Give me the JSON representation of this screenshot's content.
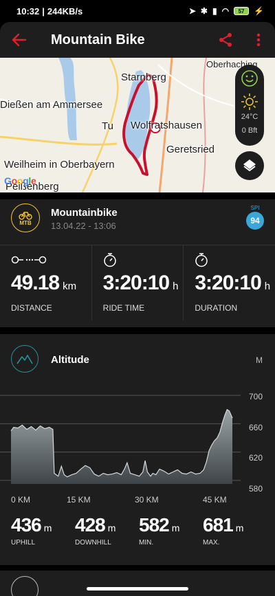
{
  "status": {
    "time": "10:32",
    "speed": "244KB/s",
    "battery": "57"
  },
  "header": {
    "title": "Mountain Bike"
  },
  "map": {
    "places": [
      "Starnberg",
      "Dießen am Ammersee",
      "Wolfratshausen",
      "Geretsried",
      "Weilheim in Oberbayern",
      "Peißenberg",
      "Tu",
      "Oberhaching"
    ],
    "brand": "Google",
    "weather": {
      "temp": "24°C",
      "wind": "0 Bft"
    }
  },
  "activity": {
    "badge": "MTB",
    "name": "Mountainbike",
    "date": "13.04.22 - 13:06",
    "spi_label": "SPI",
    "spi_value": "94",
    "stats": [
      {
        "value": "49.18",
        "unit": "km",
        "label": "DISTANCE",
        "icon": "distance-icon"
      },
      {
        "value": "3:20:10",
        "unit": "h",
        "label": "RIDE TIME",
        "icon": "stopwatch-icon"
      },
      {
        "value": "3:20:10",
        "unit": "h",
        "label": "DURATION",
        "icon": "stopwatch-icon"
      }
    ]
  },
  "altitude": {
    "title": "Altitude",
    "unit": "M",
    "summary": [
      {
        "value": "436",
        "unit": "m",
        "label": "UPHILL"
      },
      {
        "value": "428",
        "unit": "m",
        "label": "DOWNHILL"
      },
      {
        "value": "582",
        "unit": "m",
        "label": "MIN."
      },
      {
        "value": "681",
        "unit": "m",
        "label": "MAX."
      }
    ]
  },
  "chart_data": {
    "type": "area",
    "x_tick_labels": [
      "0 KM",
      "15 KM",
      "30 KM",
      "45 KM"
    ],
    "y_tick_labels": [
      "700",
      "660",
      "620",
      "580"
    ],
    "xlim": [
      0,
      49.18
    ],
    "ylim": [
      575,
      705
    ],
    "grid": true,
    "x": [
      0,
      0.6,
      1.5,
      2.5,
      3.5,
      4.5,
      5.5,
      6.5,
      7.5,
      8.5,
      9.3,
      9.6,
      10.5,
      11.2,
      11.8,
      12.5,
      13.5,
      14.5,
      15.5,
      16.5,
      17.5,
      18.5,
      19.5,
      20.5,
      21.5,
      22.5,
      23.5,
      24.5,
      25.2,
      25.8,
      26.5,
      27.5,
      28.5,
      29.3,
      29.8,
      30.3,
      31.0,
      31.5,
      32.2,
      33.0,
      34.0,
      35.0,
      36.0,
      37.0,
      38.0,
      39.0,
      40.0,
      41.0,
      42.0,
      42.8,
      43.4,
      44.0,
      44.6,
      45.2,
      45.8,
      46.4,
      47.0,
      47.5,
      48.0,
      48.5,
      49.18
    ],
    "series": [
      {
        "values": [
          650,
          655,
          654,
          658,
          652,
          656,
          651,
          657,
          653,
          655,
          652,
          590,
          586,
          600,
          588,
          585,
          588,
          590,
          596,
          601,
          598,
          589,
          586,
          590,
          588,
          589,
          591,
          588,
          596,
          605,
          590,
          588,
          586,
          592,
          608,
          592,
          586,
          590,
          588,
          596,
          593,
          589,
          592,
          595,
          590,
          589,
          592,
          589,
          590,
          595,
          606,
          622,
          630,
          636,
          640,
          648,
          662,
          672,
          680,
          678,
          668
        ]
      }
    ]
  }
}
